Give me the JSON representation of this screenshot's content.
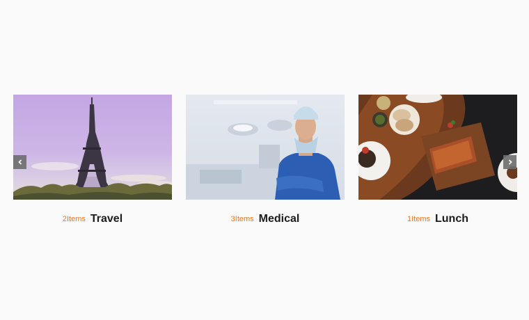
{
  "carousel": {
    "items": [
      {
        "count": "2Items",
        "title": "Travel",
        "image": "eiffel-tower-photo"
      },
      {
        "count": "3Items",
        "title": "Medical",
        "image": "surgeon-photo"
      },
      {
        "count": "1Items",
        "title": "Lunch",
        "image": "grilled-ribs-photo"
      }
    ],
    "nav": {
      "prev_icon": "chevron-left-icon",
      "next_icon": "chevron-right-icon"
    },
    "colors": {
      "count": "#e87722",
      "title": "#1c1c1c",
      "background": "#fafafa",
      "nav": "#6e6e6e"
    }
  }
}
